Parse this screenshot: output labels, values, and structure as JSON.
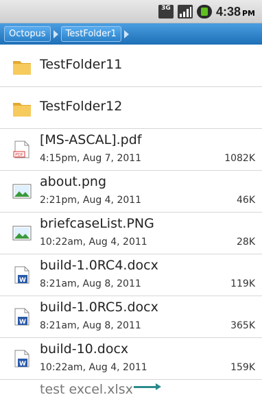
{
  "status_bar": {
    "network_label": "3G",
    "time": "4:38",
    "ampm": "PM",
    "icons": [
      "3g-icon",
      "signal-icon",
      "battery-icon"
    ]
  },
  "breadcrumb": {
    "items": [
      "Octopus",
      "TestFolder1"
    ]
  },
  "files": [
    {
      "name": "TestFolder11",
      "type": "folder"
    },
    {
      "name": "TestFolder12",
      "type": "folder"
    },
    {
      "name": "[MS-ASCAL].pdf",
      "type": "pdf",
      "date": "4:15pm, Aug 7, 2011",
      "size": "1082K"
    },
    {
      "name": "about.png",
      "type": "image",
      "date": "2:21pm, Aug 4, 2011",
      "size": "46K"
    },
    {
      "name": "briefcaseList.PNG",
      "type": "image",
      "date": "10:22am, Aug 4, 2011",
      "size": "28K"
    },
    {
      "name": "build-1.0RC4.docx",
      "type": "word",
      "date": "8:21am, Aug 8, 2011",
      "size": "119K"
    },
    {
      "name": "build-1.0RC5.docx",
      "type": "word",
      "date": "8:21am, Aug 8, 2011",
      "size": "365K"
    },
    {
      "name": "build-10.docx",
      "type": "word",
      "date": "10:22am, Aug 4, 2011",
      "size": "159K"
    },
    {
      "name": "test excel.xlsx",
      "type": "excel"
    }
  ],
  "colors": {
    "breadcrumb_bg": "#2a80c8",
    "folder": "#f2c14e",
    "pdf": "#d33",
    "image": "#3a9a3a",
    "word": "#2a5aa8"
  }
}
